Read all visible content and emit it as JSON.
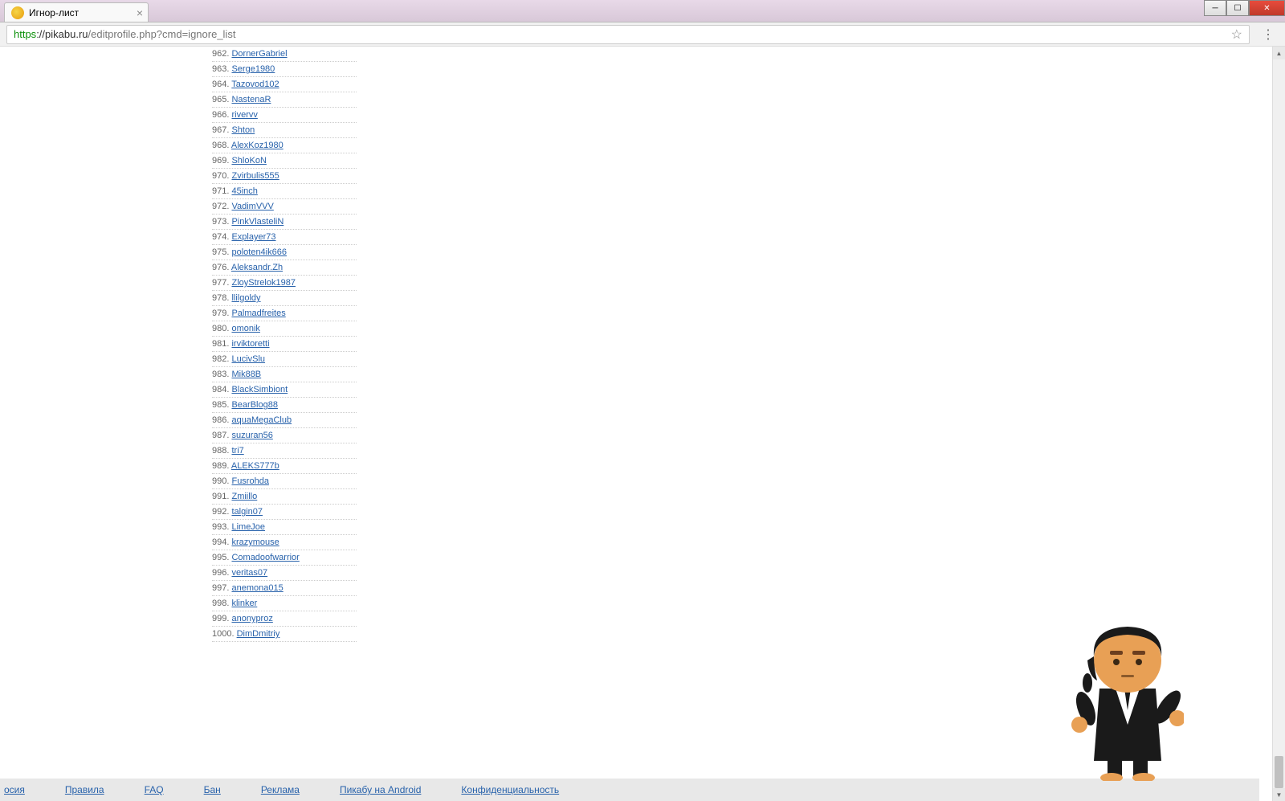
{
  "tab": {
    "title": "Игнор-лист"
  },
  "url": {
    "scheme": "https",
    "host": "://pikabu.ru",
    "path": "/editprofile.php?cmd=ignore_list"
  },
  "ignore_list": [
    {
      "n": 962,
      "name": "DornerGabriel"
    },
    {
      "n": 963,
      "name": "Serge1980"
    },
    {
      "n": 964,
      "name": "Tazovod102"
    },
    {
      "n": 965,
      "name": "NastenaR"
    },
    {
      "n": 966,
      "name": "rivervv"
    },
    {
      "n": 967,
      "name": "Shton"
    },
    {
      "n": 968,
      "name": "AlexKoz1980"
    },
    {
      "n": 969,
      "name": "ShloKoN"
    },
    {
      "n": 970,
      "name": "Zvirbulis555"
    },
    {
      "n": 971,
      "name": "45inch"
    },
    {
      "n": 972,
      "name": "VadimVVV"
    },
    {
      "n": 973,
      "name": "PinkVlasteliN"
    },
    {
      "n": 974,
      "name": "Explayer73"
    },
    {
      "n": 975,
      "name": "poloten4ik666"
    },
    {
      "n": 976,
      "name": "Aleksandr.Zh"
    },
    {
      "n": 977,
      "name": "ZloyStrelok1987"
    },
    {
      "n": 978,
      "name": "llilgoldy"
    },
    {
      "n": 979,
      "name": "Palmadfreites"
    },
    {
      "n": 980,
      "name": "omonik"
    },
    {
      "n": 981,
      "name": "irviktoretti"
    },
    {
      "n": 982,
      "name": "LucivSlu"
    },
    {
      "n": 983,
      "name": "Mik88B"
    },
    {
      "n": 984,
      "name": "BlackSimbiont"
    },
    {
      "n": 985,
      "name": "BearBlog88"
    },
    {
      "n": 986,
      "name": "aquaMegaClub"
    },
    {
      "n": 987,
      "name": "suzuran56"
    },
    {
      "n": 988,
      "name": "tri7"
    },
    {
      "n": 989,
      "name": "ALEKS777b"
    },
    {
      "n": 990,
      "name": "Fusrohda"
    },
    {
      "n": 991,
      "name": "Zmiillo"
    },
    {
      "n": 992,
      "name": "talgin07"
    },
    {
      "n": 993,
      "name": "LimeJoe"
    },
    {
      "n": 994,
      "name": "krazymouse"
    },
    {
      "n": 995,
      "name": "Comadoofwarrior"
    },
    {
      "n": 996,
      "name": "veritas07"
    },
    {
      "n": 997,
      "name": "anemona015"
    },
    {
      "n": 998,
      "name": "klinker"
    },
    {
      "n": 999,
      "name": "anonyproz"
    },
    {
      "n": 1000,
      "name": "DimDmitriy"
    }
  ],
  "footer": {
    "links": [
      "осия",
      "Правила",
      "FAQ",
      "Бан",
      "Реклама",
      "Пикабу на Android",
      "Конфиденциальность"
    ]
  }
}
